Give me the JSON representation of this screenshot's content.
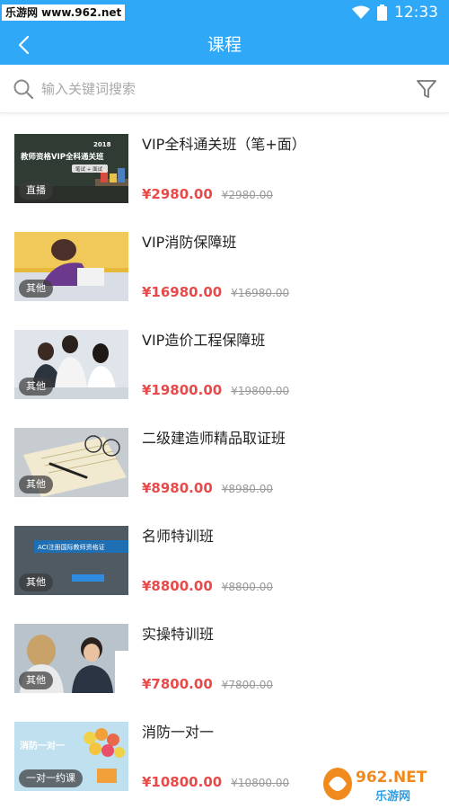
{
  "status_bar": {
    "watermark": "乐游网 www.962.net",
    "time": "12:33",
    "icons": [
      "wifi-icon",
      "battery-icon"
    ]
  },
  "header": {
    "title": "课程",
    "back_icon": "chevron-left-icon"
  },
  "search": {
    "placeholder": "输入关键词搜索",
    "value": "",
    "icon": "search-icon",
    "filter_icon": "filter-icon"
  },
  "courses": [
    {
      "title": "VIP全科通关班（笔+面）",
      "price": "¥2980.00",
      "original_price": "¥2980.00",
      "badge": "直播",
      "thumb_text": "教师资格VIP全科通关班",
      "thumb_year": "2018",
      "thumb_sub": "笔试 + 面试"
    },
    {
      "title": "VIP消防保障班",
      "price": "¥16980.00",
      "original_price": "¥16980.00",
      "badge": "其他"
    },
    {
      "title": "VIP造价工程保障班",
      "price": "¥19800.00",
      "original_price": "¥19800.00",
      "badge": "其他"
    },
    {
      "title": "二级建造师精品取证班",
      "price": "¥8980.00",
      "original_price": "¥8980.00",
      "badge": "其他"
    },
    {
      "title": "名师特训班",
      "price": "¥8800.00",
      "original_price": "¥8800.00",
      "badge": "其他",
      "thumb_text": "ACI注册国际教师资格证"
    },
    {
      "title": "实操特训班",
      "price": "¥7800.00",
      "original_price": "¥7800.00",
      "badge": "其他"
    },
    {
      "title": "消防一对一",
      "price": "¥10800.00",
      "original_price": "¥10800.00",
      "badge": "一对一约课",
      "thumb_text": "消防一对一"
    }
  ],
  "watermark_bottom": {
    "logo_text": "962.NET",
    "site_name": "乐游网"
  },
  "colors": {
    "primary": "#2ea8f7",
    "price": "#e84a4a",
    "badge_bg": "#3c3c3c"
  }
}
